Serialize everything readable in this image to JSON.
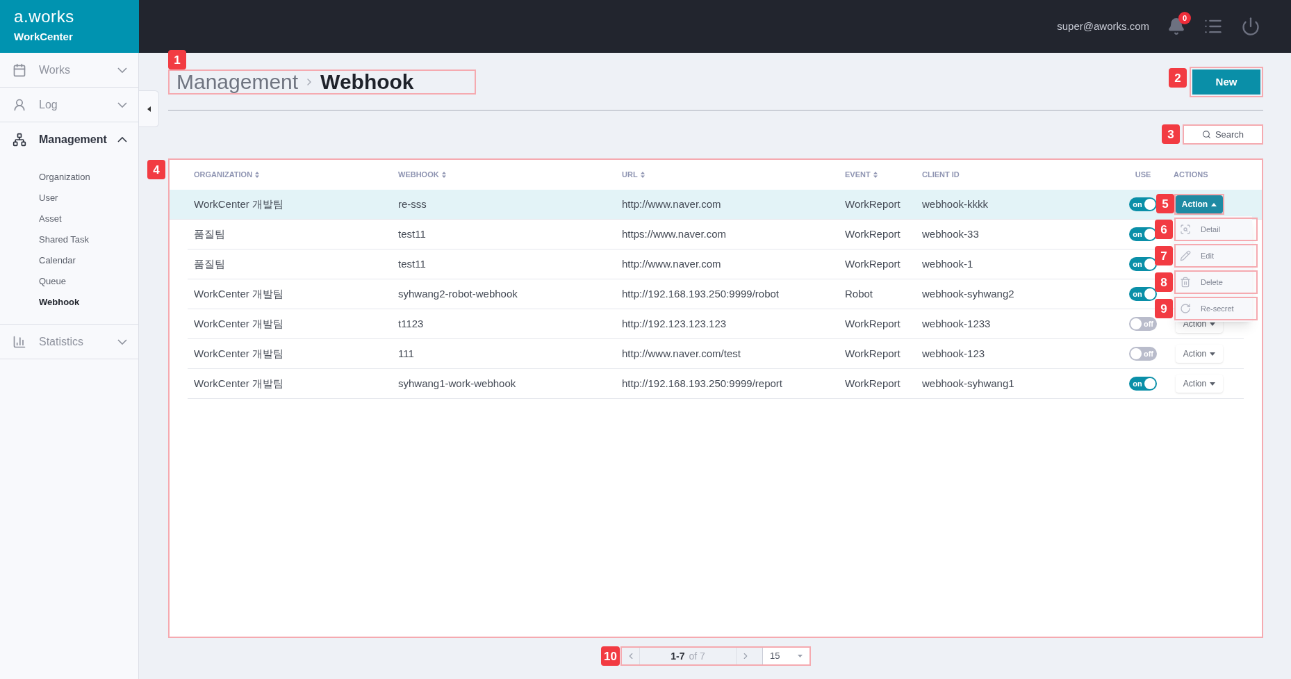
{
  "header": {
    "logo": "a.works",
    "product": "WorkCenter",
    "user": "super@aworks.com",
    "notification_count": "0"
  },
  "sidebar": {
    "items": [
      {
        "label": "Works",
        "expanded": false
      },
      {
        "label": "Log",
        "expanded": false
      },
      {
        "label": "Management",
        "expanded": true,
        "children": [
          {
            "label": "Organization",
            "selected": false
          },
          {
            "label": "User",
            "selected": false
          },
          {
            "label": "Asset",
            "selected": false
          },
          {
            "label": "Shared Task",
            "selected": false
          },
          {
            "label": "Calendar",
            "selected": false
          },
          {
            "label": "Queue",
            "selected": false
          },
          {
            "label": "Webhook",
            "selected": true
          }
        ]
      },
      {
        "label": "Statistics",
        "expanded": false
      }
    ]
  },
  "page": {
    "breadcrumb": [
      {
        "label": "Management",
        "current": false
      },
      {
        "label": "Webhook",
        "current": true
      }
    ],
    "breadcrumb_callout": "1",
    "new_button": {
      "label": "New",
      "callout": "2"
    },
    "search_button": {
      "label": "Search",
      "callout": "3"
    }
  },
  "table": {
    "callout": "4",
    "columns": [
      {
        "label": "ORGANIZATION",
        "sortable": true
      },
      {
        "label": "WEBHOOK",
        "sortable": true
      },
      {
        "label": "URL",
        "sortable": true
      },
      {
        "label": "EVENT",
        "sortable": true
      },
      {
        "label": "CLIENT ID",
        "sortable": false
      },
      {
        "label": "USE",
        "sortable": false
      },
      {
        "label": "ACTIONS",
        "sortable": false
      }
    ],
    "rows": [
      {
        "organization": "WorkCenter 개발팀",
        "webhook": "re-sss",
        "url": "http://www.naver.com",
        "event": "WorkReport",
        "client_id": "webhook-kkkk",
        "use": {
          "on": true,
          "label": "on"
        },
        "action": {
          "label": "Action",
          "open": true,
          "callout": "5"
        },
        "selected": true
      },
      {
        "organization": "품질팀",
        "webhook": "test11",
        "url": "https://www.naver.com",
        "event": "WorkReport",
        "client_id": "webhook-33",
        "use": {
          "on": true,
          "label": "on"
        },
        "selected": false
      },
      {
        "organization": "품질팀",
        "webhook": "test11",
        "url": "http://www.naver.com",
        "event": "WorkReport",
        "client_id": "webhook-1",
        "use": {
          "on": true,
          "label": "on"
        },
        "selected": false
      },
      {
        "organization": "WorkCenter 개발팀",
        "webhook": "syhwang2-robot-webhook",
        "url": "http://192.168.193.250:9999/robot",
        "event": "Robot",
        "client_id": "webhook-syhwang2",
        "use": {
          "on": true,
          "label": "on"
        },
        "selected": false
      },
      {
        "organization": "WorkCenter 개발팀",
        "webhook": "t1123",
        "url": "http://192.123.123.123",
        "event": "WorkReport",
        "client_id": "webhook-1233",
        "use": {
          "on": false,
          "label": "off"
        },
        "action": {
          "label": "Action",
          "open": false
        },
        "selected": false
      },
      {
        "organization": "WorkCenter 개발팀",
        "webhook": "111",
        "url": "http://www.naver.com/test",
        "event": "WorkReport",
        "client_id": "webhook-123",
        "use": {
          "on": false,
          "label": "off"
        },
        "action": {
          "label": "Action",
          "open": false
        },
        "selected": false
      },
      {
        "organization": "WorkCenter 개발팀",
        "webhook": "syhwang1-work-webhook",
        "url": "http://192.168.193.250:9999/report",
        "event": "WorkReport",
        "client_id": "webhook-syhwang1",
        "use": {
          "on": true,
          "label": "on"
        },
        "action": {
          "label": "Action",
          "open": false
        },
        "selected": false
      }
    ],
    "action_menu": [
      {
        "kind": "detail",
        "label": "Detail",
        "callout": "6"
      },
      {
        "kind": "edit",
        "label": "Edit",
        "callout": "7"
      },
      {
        "kind": "delete",
        "label": "Delete",
        "callout": "8"
      },
      {
        "kind": "resecret",
        "label": "Re-secret",
        "callout": "9"
      }
    ]
  },
  "pagination": {
    "range": "1-7",
    "total": "of 7",
    "page_size": "15",
    "callout": "10"
  }
}
